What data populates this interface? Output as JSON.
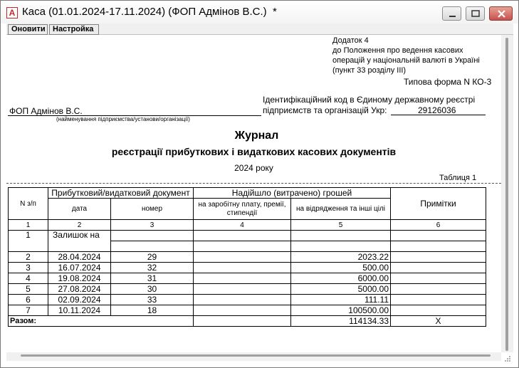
{
  "window": {
    "title": "Каса (01.01.2024-17.11.2024) (ФОП Адмінов В.С.)  *",
    "app_icon": "report-app-icon"
  },
  "toolbar": {
    "refresh_label": "Оновити",
    "settings_label": "Настройка"
  },
  "report": {
    "annex": {
      "line1": "Додаток 4",
      "line2": "до Положення про ведення касових",
      "line3": "операцій у національній валюті в Україні",
      "line4": "(пункт 33 розділу ІІІ)"
    },
    "form_name": "Типова форма N КО-3",
    "id_code_line1": "Ідентифікаційний код в Єдиному державному реєстрі",
    "id_code_line2": "підприємств та організацій Укр:",
    "id_code_value": "29126036",
    "company_name": "ФОП Адмінов В.С.",
    "company_caption": "(найменування підприємства/установи/організації)",
    "title": "Журнал",
    "subtitle": "реєстрації прибуткових і видаткових касових документів",
    "year": "2024 року",
    "table_label": "Таблиця 1"
  },
  "table": {
    "headers": {
      "num": "N з/п",
      "doc_group": "Прибутковий/видатковий документ",
      "date": "дата",
      "number": "номер",
      "money_group": "Надійшло (витрачено) грошей",
      "salary": "на заробітну плату, премії, стипендії",
      "other": "на відрядження та інші цілі",
      "notes": "Примітки"
    },
    "col_numbers": [
      "1",
      "2",
      "3",
      "4",
      "5",
      "6"
    ],
    "balance_row": {
      "num": "1",
      "label": "Залишок на"
    },
    "rows": [
      {
        "num": "2",
        "date": "28.04.2024",
        "number": "29",
        "salary": "",
        "other": "2023.22",
        "notes": ""
      },
      {
        "num": "3",
        "date": "16.07.2024",
        "number": "32",
        "salary": "",
        "other": "500.00",
        "notes": ""
      },
      {
        "num": "4",
        "date": "19.08.2024",
        "number": "31",
        "salary": "",
        "other": "6000.00",
        "notes": ""
      },
      {
        "num": "5",
        "date": "27.08.2024",
        "number": "30",
        "salary": "",
        "other": "5000.00",
        "notes": ""
      },
      {
        "num": "6",
        "date": "02.09.2024",
        "number": "33",
        "salary": "",
        "other": "111.11",
        "notes": ""
      },
      {
        "num": "7",
        "date": "10.11.2024",
        "number": "18",
        "salary": "",
        "other": "100500.00",
        "notes": ""
      }
    ],
    "total": {
      "label": "Разом:",
      "other": "114134.33",
      "notes": "X"
    }
  },
  "colors": {
    "close_button": "#c75050",
    "background": "#ffffff",
    "chrome": "#f0f0f0"
  }
}
